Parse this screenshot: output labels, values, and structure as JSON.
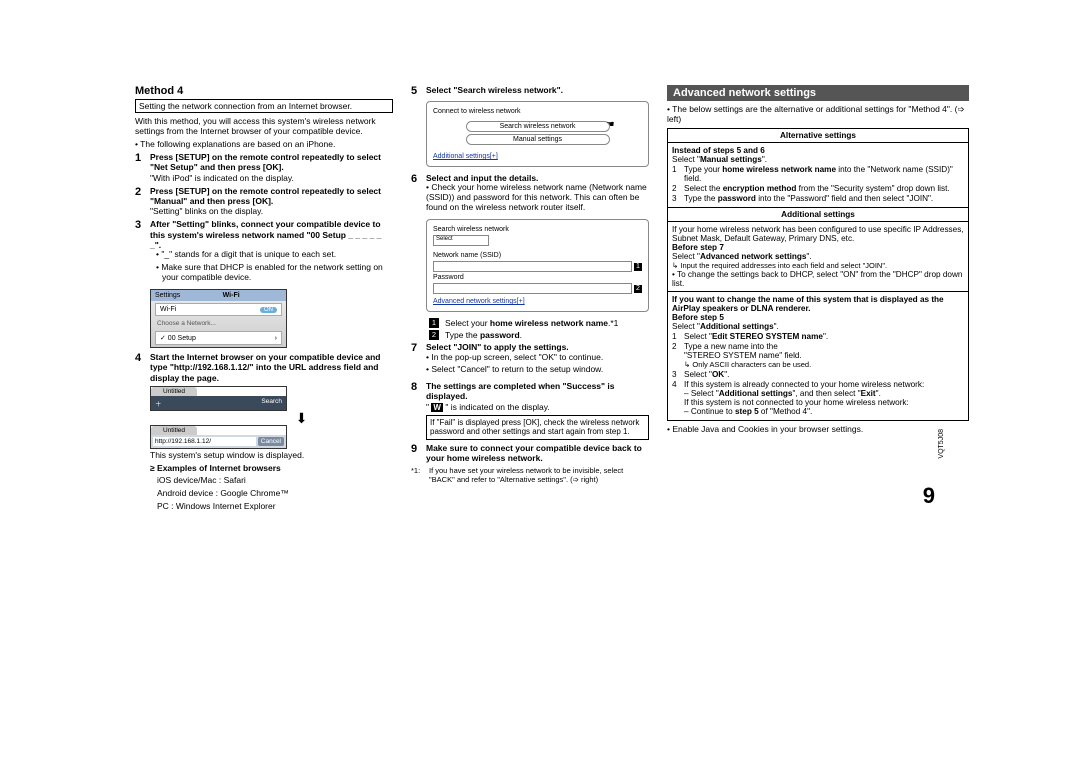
{
  "col1": {
    "method_heading": "Method 4",
    "boxed": "Setting the network connection from an Internet browser.",
    "intro": "With this method, you will access this system's wireless network settings from the Internet browser of your compatible device.",
    "intro_bullet": "• The following explanations are based on an iPhone.",
    "steps": {
      "1": {
        "bold": "Press [SETUP] on the remote control repeatedly to select \"Net Setup\" and then press [OK].",
        "after": "\"With iPod\" is indicated on the display."
      },
      "2": {
        "bold": "Press [SETUP] on the remote control repeatedly to select \"Manual\" and then press [OK].",
        "after": "\"Setting\" blinks on the display."
      },
      "3": {
        "bold": "After \"Setting\" blinks, connect your compatible device to this system's wireless network named \"00 Setup _ _ _ _ _ _\".",
        "sub1": "• \"_\" stands for a digit that is unique to each set.",
        "sub2": "• Make sure that DHCP is enabled for the network setting on your compatible device."
      },
      "4": {
        "bold": "Start the Internet browser on your compatible device and type \"http://192.168.1.12/\" into the URL address field and display the page."
      }
    },
    "iphone": {
      "settings": "Settings",
      "header": "Wi-Fi",
      "wifi_row": "Wi-Fi",
      "on": "ON",
      "choose": "Choose a Network...",
      "net": "✓ 00 Setup"
    },
    "urlshot1": {
      "tab": "Untitled",
      "search": "Search",
      "url": "http://192.168.1.12/",
      "cancel": "Cancel"
    },
    "after4a": "This system's setup window is displayed.",
    "browsers_hd": "≥ Examples of Internet browsers",
    "browsers1": "iOS device/Mac : Safari",
    "browsers2": "Android device : Google Chrome™",
    "browsers3": "PC : Windows Internet Explorer"
  },
  "col2": {
    "s5": {
      "bold": "Select \"Search wireless network\"."
    },
    "fig1": {
      "title": "Connect to wireless network",
      "b1": "Search wireless network",
      "b2": "Manual settings",
      "link": "Additional settings[+]"
    },
    "s6": {
      "bold": "Select and input the details.",
      "bullet": "• Check your home wireless network name (Network name (SSID)) and password for this network. This can often be found on the wireless network router itself."
    },
    "fig2": {
      "title": "Search wireless network",
      "select": "Select",
      "f1": "Network name (SSID)",
      "f2": "Password",
      "link": "Advanced network settings[+]"
    },
    "sq1_a": "Select your ",
    "sq1_b": "home wireless network name",
    "sq1_c": ".*1",
    "sq2_a": "Type the ",
    "sq2_b": "password",
    "sq2_c": ".",
    "s7": {
      "bold": "Select \"JOIN\" to apply the settings.",
      "b1": "• In the pop-up screen, select \"OK\" to continue.",
      "b2": "• Select \"Cancel\" to return to the setup window."
    },
    "s8": {
      "bold": "The settings are completed when \"Success\" is displayed.",
      "after": "\" W \" is indicated on the display."
    },
    "note": "If \"Fail\" is displayed press [OK], check the wireless network password and other settings and start again from step 1.",
    "s9": {
      "bold": "Make sure to connect your compatible device back to your home wireless network."
    },
    "foot_label": "*1:",
    "foot": "If you have set your wireless network to be invisible, select \"BACK\" and refer to \"Alternative settings\". (➩ right)"
  },
  "col3": {
    "bar": "Advanced network settings",
    "lead": "• The below settings are the alternative or additional settings for \"Method 4\". (➩ left)",
    "alt": {
      "hd": "Alternative settings",
      "i1b": "Instead of steps 5 and 6",
      "i1": "Select \"Manual settings\".",
      "r1": "Type your home wireless network name into the \"Network name (SSID)\" field.",
      "r2": "Select the encryption method from the \"Security system\" drop down list.",
      "r3": "Type the password into the \"Password\" field and then select \"JOIN\"."
    },
    "add": {
      "hd": "Additional settings",
      "p1": "If your home wireless network has been configured to use specific IP Addresses, Subnet Mask, Default Gateway, Primary DNS, etc.",
      "b7b": "Before step 7",
      "b7": "Select \"Advanced network settings\".",
      "b7s1": "↳ Input the required addresses into each field and select \"JOIN\".",
      "b7s2": "• To change the settings back to DHCP, select \"ON\" from the \"DHCP\" drop down list.",
      "mid_b": "If you want to change the name of this system that is displayed as the AirPlay speakers or DLNA renderer.",
      "b5b": "Before step 5",
      "b5": "Select \"Additional settings\".",
      "r1": "Select \"Edit STEREO SYSTEM name\".",
      "r2a": "Type a new name into the",
      "r2b": "\"STEREO SYSTEM name\" field.",
      "r2c": "↳ Only ASCII characters can be used.",
      "r3": "Select \"OK\".",
      "r4a": "If this system is already connected to your home wireless network:",
      "r4b": "– Select \"Additional settings\", and then select \"Exit\".",
      "r4c": "If this system is not connected to your home wireless network:",
      "r4d": "– Continue to step 5 of \"Method 4\"."
    },
    "tail": "• Enable Java and Cookies in your browser settings."
  },
  "page_number": "9",
  "side_code": "VQT5J08"
}
